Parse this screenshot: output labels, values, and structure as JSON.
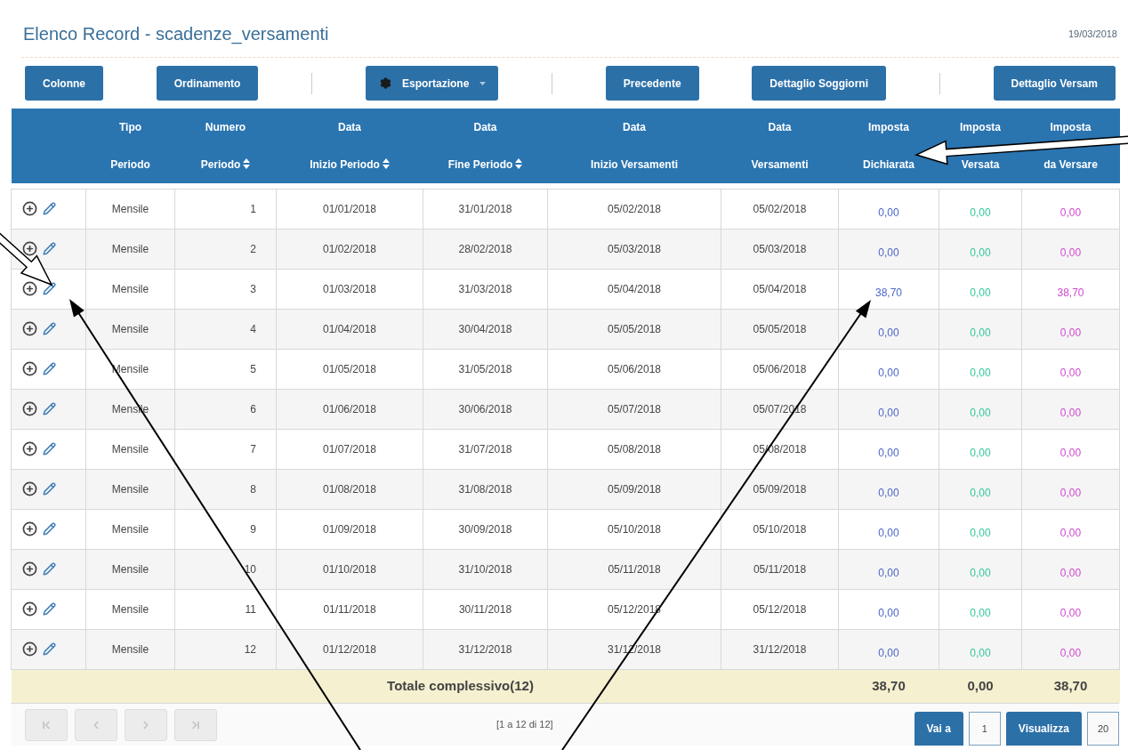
{
  "title": "Elenco Record - scadenze_versamenti",
  "date": "19/03/2018",
  "toolbar": [
    {
      "kind": "button",
      "label": "Colonne"
    },
    {
      "kind": "button",
      "label": "Ordinamento"
    },
    {
      "kind": "separator"
    },
    {
      "kind": "menu",
      "label": "Esportazione"
    },
    {
      "kind": "separator"
    },
    {
      "kind": "button",
      "label": "Precedente"
    },
    {
      "kind": "button",
      "label": "Dettaglio Soggiorni"
    },
    {
      "kind": "separator"
    },
    {
      "kind": "button",
      "label": "Dettaglio Versam"
    }
  ],
  "table": {
    "columns": [
      {
        "sortable": false
      },
      {
        "top": "Tipo",
        "bottom": "Periodo",
        "sortable": false
      },
      {
        "top": "Numero",
        "bottom": "Periodo",
        "sortable": true
      },
      {
        "top": "Data",
        "bottom": "Inizio Periodo",
        "sortable": true
      },
      {
        "top": "Data",
        "bottom": "Fine Periodo",
        "sortable": true
      },
      {
        "top": "Data",
        "bottom": "Inizio Versamenti",
        "sortable": false
      },
      {
        "top": "Data",
        "bottom": "Versamenti",
        "sortable": false
      },
      {
        "top": "Imposta",
        "bottom": "Dichiarata",
        "sortable": false
      },
      {
        "top": "Imposta",
        "bottom": "Versata",
        "sortable": false
      },
      {
        "top": "Imposta",
        "bottom": "da Versare",
        "sortable": false
      }
    ],
    "rows": [
      {
        "tipo": "Mensile",
        "numero": "1",
        "inizio": "01/01/2018",
        "fine": "31/01/2018",
        "inizio_vers": "05/02/2018",
        "vers": "05/02/2018",
        "dichiarata": "0,00",
        "versata": "0,00",
        "da_versare": "0,00"
      },
      {
        "tipo": "Mensile",
        "numero": "2",
        "inizio": "01/02/2018",
        "fine": "28/02/2018",
        "inizio_vers": "05/03/2018",
        "vers": "05/03/2018",
        "dichiarata": "0,00",
        "versata": "0,00",
        "da_versare": "0,00"
      },
      {
        "tipo": "Mensile",
        "numero": "3",
        "inizio": "01/03/2018",
        "fine": "31/03/2018",
        "inizio_vers": "05/04/2018",
        "vers": "05/04/2018",
        "dichiarata": "38,70",
        "versata": "0,00",
        "da_versare": "38,70"
      },
      {
        "tipo": "Mensile",
        "numero": "4",
        "inizio": "01/04/2018",
        "fine": "30/04/2018",
        "inizio_vers": "05/05/2018",
        "vers": "05/05/2018",
        "dichiarata": "0,00",
        "versata": "0,00",
        "da_versare": "0,00"
      },
      {
        "tipo": "Mensile",
        "numero": "5",
        "inizio": "01/05/2018",
        "fine": "31/05/2018",
        "inizio_vers": "05/06/2018",
        "vers": "05/06/2018",
        "dichiarata": "0,00",
        "versata": "0,00",
        "da_versare": "0,00"
      },
      {
        "tipo": "Mensile",
        "numero": "6",
        "inizio": "01/06/2018",
        "fine": "30/06/2018",
        "inizio_vers": "05/07/2018",
        "vers": "05/07/2018",
        "dichiarata": "0,00",
        "versata": "0,00",
        "da_versare": "0,00"
      },
      {
        "tipo": "Mensile",
        "numero": "7",
        "inizio": "01/07/2018",
        "fine": "31/07/2018",
        "inizio_vers": "05/08/2018",
        "vers": "05/08/2018",
        "dichiarata": "0,00",
        "versata": "0,00",
        "da_versare": "0,00"
      },
      {
        "tipo": "Mensile",
        "numero": "8",
        "inizio": "01/08/2018",
        "fine": "31/08/2018",
        "inizio_vers": "05/09/2018",
        "vers": "05/09/2018",
        "dichiarata": "0,00",
        "versata": "0,00",
        "da_versare": "0,00"
      },
      {
        "tipo": "Mensile",
        "numero": "9",
        "inizio": "01/09/2018",
        "fine": "30/09/2018",
        "inizio_vers": "05/10/2018",
        "vers": "05/10/2018",
        "dichiarata": "0,00",
        "versata": "0,00",
        "da_versare": "0,00"
      },
      {
        "tipo": "Mensile",
        "numero": "10",
        "inizio": "01/10/2018",
        "fine": "31/10/2018",
        "inizio_vers": "05/11/2018",
        "vers": "05/11/2018",
        "dichiarata": "0,00",
        "versata": "0,00",
        "da_versare": "0,00"
      },
      {
        "tipo": "Mensile",
        "numero": "11",
        "inizio": "01/11/2018",
        "fine": "30/11/2018",
        "inizio_vers": "05/12/2018",
        "vers": "05/12/2018",
        "dichiarata": "0,00",
        "versata": "0,00",
        "da_versare": "0,00"
      },
      {
        "tipo": "Mensile",
        "numero": "12",
        "inizio": "01/12/2018",
        "fine": "31/12/2018",
        "inizio_vers": "31/12/2018",
        "vers": "31/12/2018",
        "dichiarata": "0,00",
        "versata": "0,00",
        "da_versare": "0,00"
      }
    ],
    "totals": {
      "label": "Totale complessivo(12)",
      "dichiarata": "38,70",
      "versata": "0,00",
      "da_versare": "38,70"
    }
  },
  "pager": {
    "nav": [
      {
        "kind": "first",
        "disabled": true
      },
      {
        "kind": "prev",
        "disabled": true
      },
      {
        "kind": "next",
        "disabled": true
      },
      {
        "kind": "last",
        "disabled": true
      }
    ],
    "range": "[1 a 12 di 12]",
    "goto_label": "Vai a",
    "page": "1",
    "show_label": "Visualizza",
    "page_size": "20"
  }
}
